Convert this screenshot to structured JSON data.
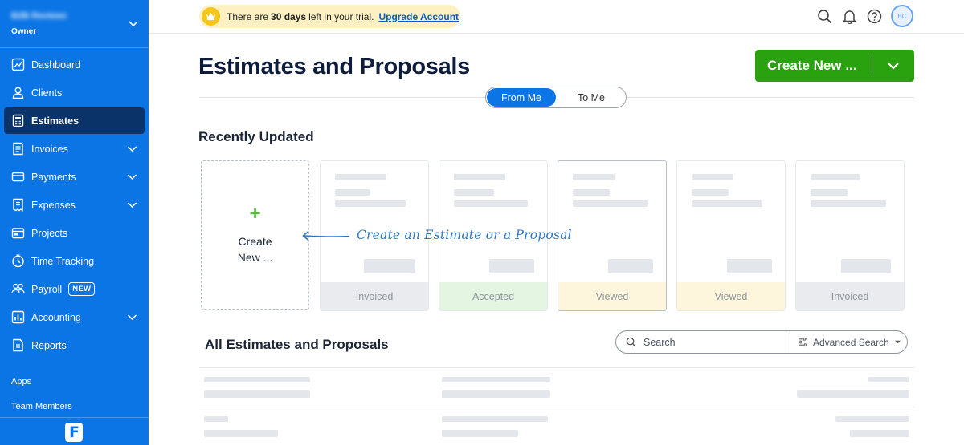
{
  "sidebar": {
    "business_name": "B2B Reviews",
    "role": "Owner",
    "items": [
      {
        "label": "Dashboard",
        "icon": "dashboard-icon",
        "active": false,
        "expandable": false
      },
      {
        "label": "Clients",
        "icon": "clients-icon",
        "active": false,
        "expandable": false
      },
      {
        "label": "Estimates",
        "icon": "estimates-icon",
        "active": true,
        "expandable": false
      },
      {
        "label": "Invoices",
        "icon": "invoices-icon",
        "active": false,
        "expandable": true
      },
      {
        "label": "Payments",
        "icon": "payments-icon",
        "active": false,
        "expandable": true
      },
      {
        "label": "Expenses",
        "icon": "expenses-icon",
        "active": false,
        "expandable": true
      },
      {
        "label": "Projects",
        "icon": "projects-icon",
        "active": false,
        "expandable": false
      },
      {
        "label": "Time Tracking",
        "icon": "clock-icon",
        "active": false,
        "expandable": false
      },
      {
        "label": "Payroll",
        "icon": "payroll-icon",
        "active": false,
        "expandable": false,
        "badge": "NEW"
      },
      {
        "label": "Accounting",
        "icon": "accounting-icon",
        "active": false,
        "expandable": true
      },
      {
        "label": "Reports",
        "icon": "reports-icon",
        "active": false,
        "expandable": false
      }
    ],
    "apps_label": "Apps",
    "team_label": "Team Members",
    "logo_letter": "F"
  },
  "topbar": {
    "trial_prefix": "There are",
    "trial_days": "30 days",
    "trial_suffix": "left in your trial.",
    "upgrade_label": "Upgrade Account",
    "avatar_initials": "BC"
  },
  "main": {
    "title": "Estimates and Proposals",
    "create_button": "Create New ...",
    "toggle": {
      "from_me": "From Me",
      "to_me": "To Me",
      "selected": "From Me"
    },
    "recently_updated_title": "Recently Updated",
    "create_card": {
      "line1": "Create",
      "line2": "New ..."
    },
    "hint": "Create an Estimate or a Proposal",
    "cards": [
      {
        "status": "Invoiced"
      },
      {
        "status": "Accepted"
      },
      {
        "status": "Viewed"
      },
      {
        "status": "Viewed"
      },
      {
        "status": "Invoiced"
      }
    ],
    "all_title": "All Estimates and Proposals",
    "search_placeholder": "Search",
    "advanced_search": "Advanced Search"
  },
  "colors": {
    "sidebar_bg": "#0c75e5",
    "active_nav": "#0a3369",
    "create_green": "#2aa10f",
    "status_invoiced": "#e9ebee",
    "status_accepted": "#e4f5e1",
    "status_viewed": "#fdf5dc"
  }
}
